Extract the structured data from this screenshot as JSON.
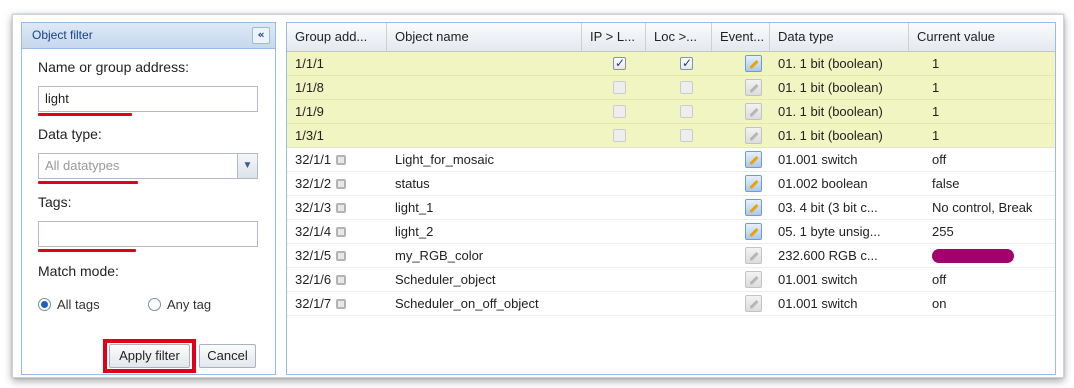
{
  "filter_panel": {
    "title": "Object filter",
    "collapse_icon": "double-chevron-left-icon",
    "name_label": "Name or group address:",
    "name_value": "light",
    "datatype_label": "Data type:",
    "datatype_value": "All datatypes",
    "tags_label": "Tags:",
    "tags_value": "",
    "match_label": "Match mode:",
    "match_options": [
      "All tags",
      "Any tag"
    ],
    "match_selected": "All tags",
    "apply_label": "Apply filter",
    "cancel_label": "Cancel",
    "highlight_color": "#e0001a"
  },
  "grid": {
    "columns": [
      "Group add...",
      "Object name",
      "IP > L...",
      "Loc >...",
      "Event...",
      "Data type",
      "Current value"
    ],
    "rows": [
      {
        "address": "1/1/1",
        "name": "",
        "ip": true,
        "loc": true,
        "event": "active",
        "datatype": "01. 1 bit (boolean)",
        "value": "1",
        "highlight": true
      },
      {
        "address": "1/1/8",
        "name": "",
        "ip": false,
        "loc": false,
        "event": "disabled",
        "datatype": "01. 1 bit (boolean)",
        "value": "1",
        "highlight": true
      },
      {
        "address": "1/1/9",
        "name": "",
        "ip": false,
        "loc": false,
        "event": "disabled",
        "datatype": "01. 1 bit (boolean)",
        "value": "1",
        "highlight": true
      },
      {
        "address": "1/3/1",
        "name": "",
        "ip": false,
        "loc": false,
        "event": "disabled",
        "datatype": "01. 1 bit (boolean)",
        "value": "1",
        "highlight": true
      },
      {
        "address": "32/1/1",
        "name": "Light_for_mosaic",
        "event": "active",
        "datatype": "01.001 switch",
        "value": "off"
      },
      {
        "address": "32/1/2",
        "name": "status",
        "event": "active",
        "datatype": "01.002 boolean",
        "value": "false"
      },
      {
        "address": "32/1/3",
        "name": "light_1",
        "event": "active",
        "datatype": "03. 4 bit (3 bit c...",
        "value": "No control, Break"
      },
      {
        "address": "32/1/4",
        "name": "light_2",
        "event": "active",
        "datatype": "05. 1 byte unsig...",
        "value": "255"
      },
      {
        "address": "32/1/5",
        "name": "my_RGB_color",
        "event": "disabled",
        "datatype": "232.600 RGB c...",
        "value": "",
        "value_color": "#a3006e"
      },
      {
        "address": "32/1/6",
        "name": "Scheduler_object",
        "event": "disabled",
        "datatype": "01.001 switch",
        "value": "off"
      },
      {
        "address": "32/1/7",
        "name": "Scheduler_on_off_object",
        "event": "disabled",
        "datatype": "01.001 switch",
        "value": "on"
      }
    ],
    "highlight_row_color": "#f0f5c1"
  }
}
